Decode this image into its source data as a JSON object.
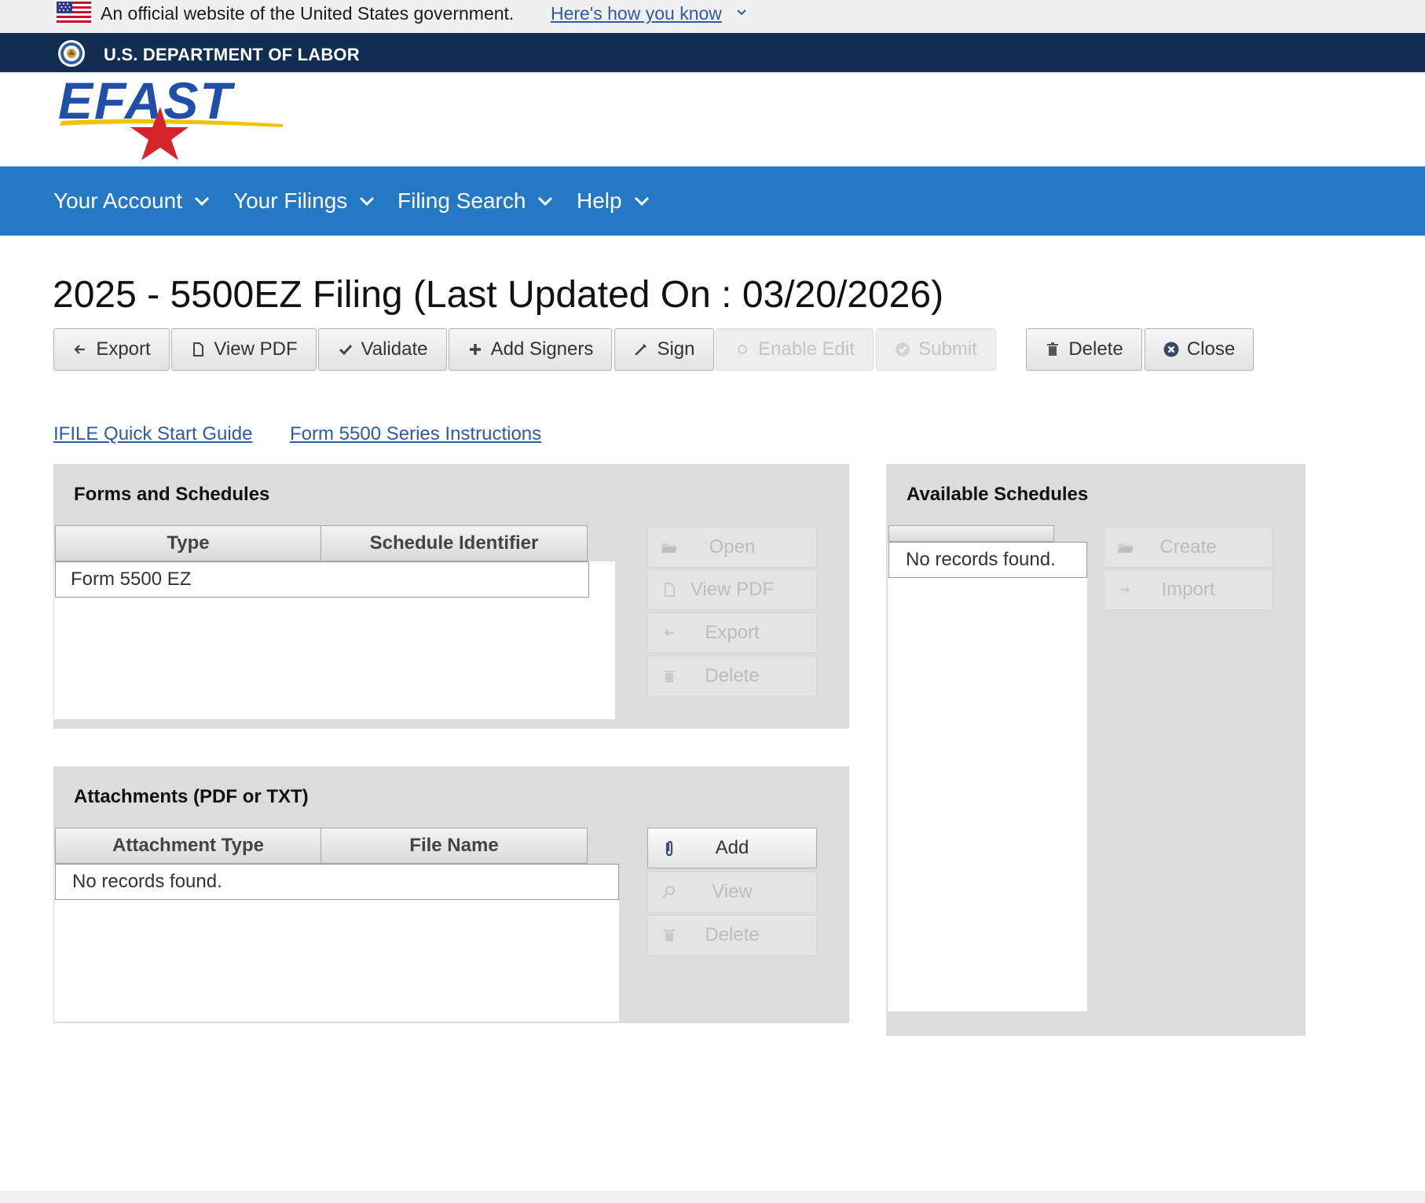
{
  "gov_banner": {
    "text": "An official website of the United States government.",
    "link": "Here's how you know"
  },
  "agency_bar": {
    "name": "U.S. DEPARTMENT OF LABOR"
  },
  "logo": {
    "text": "EFAST"
  },
  "nav": {
    "items": [
      {
        "label": "Your Account"
      },
      {
        "label": "Your Filings"
      },
      {
        "label": "Filing Search"
      },
      {
        "label": "Help"
      }
    ]
  },
  "page": {
    "title": "2025 - 5500EZ Filing (Last Updated On : 03/20/2026)"
  },
  "toolbar": {
    "export": "Export",
    "view_pdf": "View PDF",
    "validate": "Validate",
    "add_signers": "Add Signers",
    "sign": "Sign",
    "enable_edit": "Enable Edit",
    "submit": "Submit",
    "delete": "Delete",
    "close": "Close"
  },
  "links": {
    "quick_start": "IFILE Quick Start Guide",
    "instructions": "Form 5500 Series Instructions"
  },
  "forms_panel": {
    "title": "Forms and Schedules",
    "columns": [
      "Type",
      "Schedule Identifier"
    ],
    "rows": [
      [
        "Form 5500 EZ",
        ""
      ]
    ],
    "buttons": {
      "open": "Open",
      "view_pdf": "View PDF",
      "export": "Export",
      "delete": "Delete"
    }
  },
  "attachments_panel": {
    "title": "Attachments (PDF or TXT)",
    "columns": [
      "Attachment Type",
      "File Name"
    ],
    "empty": "No records found.",
    "buttons": {
      "add": "Add",
      "view": "View",
      "delete": "Delete"
    }
  },
  "schedules_panel": {
    "title": "Available Schedules",
    "empty": "No records found.",
    "buttons": {
      "create": "Create",
      "import": "Import"
    }
  },
  "colors": {
    "nav_blue": "#2478c4",
    "agency_navy": "#112e51",
    "link_blue": "#2e5aa7",
    "panel_gray": "#dcdcdc"
  }
}
